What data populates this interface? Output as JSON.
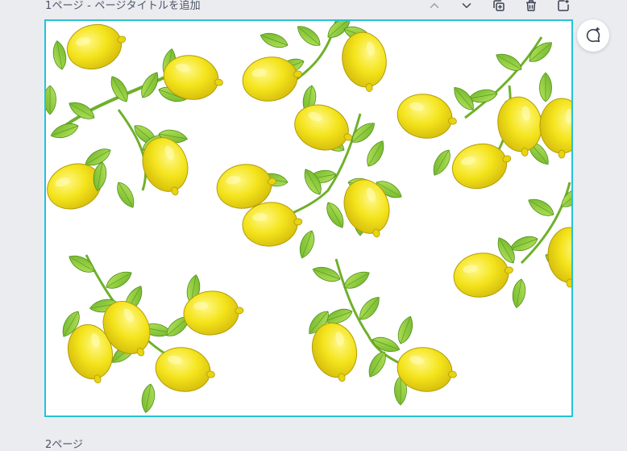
{
  "page": {
    "title": "1ページ - ページタイトルを追加",
    "next_page_label": "2ページ"
  },
  "toolbar": {
    "buttons": [
      {
        "name": "move-page-up-button",
        "icon": "chevron-up-icon",
        "enabled": false
      },
      {
        "name": "move-page-down-button",
        "icon": "chevron-down-icon",
        "enabled": true
      },
      {
        "name": "duplicate-page-button",
        "icon": "duplicate-icon",
        "enabled": true
      },
      {
        "name": "delete-page-button",
        "icon": "trash-icon",
        "enabled": true
      },
      {
        "name": "add-page-button",
        "icon": "add-page-icon",
        "enabled": true
      }
    ]
  },
  "comment": {
    "icon": "add-comment-icon"
  },
  "colors": {
    "canvas_border": "#25c3d6",
    "lemon": "#f2e21a",
    "leaf": "#8fcf3f",
    "stem": "#6fb02a",
    "app_background": "#ebecf0"
  },
  "canvas": {
    "content": "lemon-branch-pattern"
  }
}
